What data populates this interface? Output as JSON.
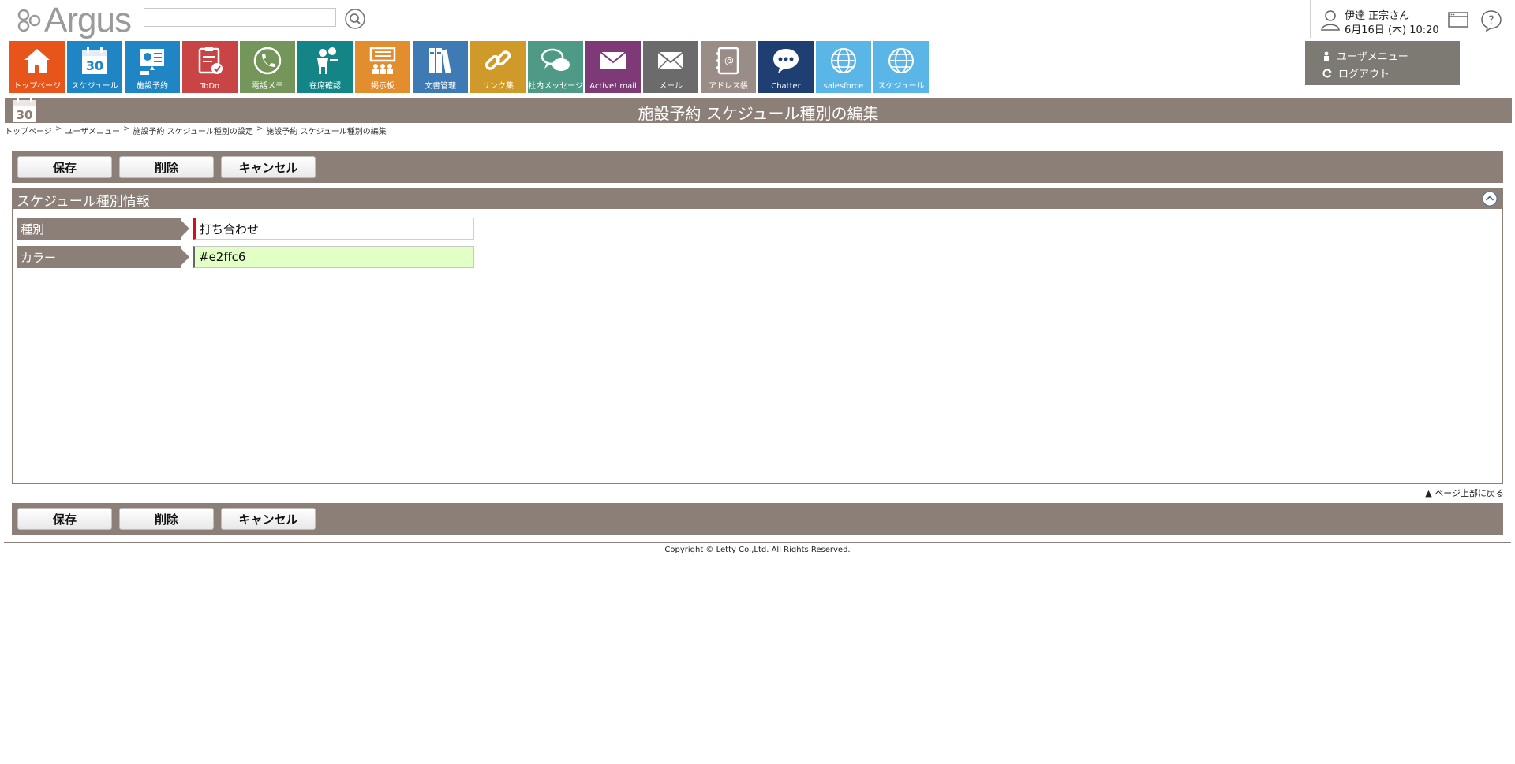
{
  "app": {
    "logo_text": "Argus"
  },
  "search": {
    "placeholder": ""
  },
  "user": {
    "name": "伊達 正宗さん",
    "datetime": "6月16日 (木) 10:20"
  },
  "user_menu": {
    "menu_label": "ユーザメニュー",
    "logout_label": "ログアウト"
  },
  "tiles": [
    {
      "label": "トップページ",
      "color": "#e8551b",
      "icon": "home-icon"
    },
    {
      "label": "スケジュール",
      "color": "#1f85c5",
      "icon": "calendar-icon",
      "icon_text": "30"
    },
    {
      "label": "施設予約",
      "color": "#1f85c5",
      "icon": "facility-icon"
    },
    {
      "label": "ToDo",
      "color": "#c94545",
      "icon": "todo-icon"
    },
    {
      "label": "電話メモ",
      "color": "#75965b",
      "icon": "phone-icon"
    },
    {
      "label": "在席確認",
      "color": "#138586",
      "icon": "presence-icon"
    },
    {
      "label": "掲示板",
      "color": "#e28d2e",
      "icon": "board-icon"
    },
    {
      "label": "文書管理",
      "color": "#3e7ab4",
      "icon": "document-icon"
    },
    {
      "label": "リンク集",
      "color": "#d09a2a",
      "icon": "link-icon"
    },
    {
      "label": "社内メッセージ",
      "color": "#4f9a87",
      "icon": "message-icon"
    },
    {
      "label": "Active! mail",
      "color": "#7d3a77",
      "icon": "active-mail-icon"
    },
    {
      "label": "メール",
      "color": "#6b6b6b",
      "icon": "mail-icon"
    },
    {
      "label": "アドレス帳",
      "color": "#9a8c86",
      "icon": "address-book-icon"
    },
    {
      "label": "Chatter",
      "color": "#1f3e72",
      "icon": "chatter-icon"
    },
    {
      "label": "salesforce",
      "color": "#59b6e6",
      "icon": "globe-icon"
    },
    {
      "label": "スケジュール",
      "color": "#59b6e6",
      "icon": "globe-icon"
    }
  ],
  "page": {
    "title": "施設予約 スケジュール種別の編集"
  },
  "breadcrumb": [
    "トップページ",
    "ユーザメニュー",
    "施設予約 スケジュール種別の設定",
    "施設予約 スケジュール種別の編集"
  ],
  "breadcrumb_sep": ">",
  "buttons": {
    "save": "保存",
    "delete": "削除",
    "cancel": "キャンセル"
  },
  "section": {
    "title": "スケジュール種別情報",
    "fields": [
      {
        "label": "種別",
        "value": "打ち合わせ"
      },
      {
        "label": "カラー",
        "value": "#e2ffc6"
      }
    ]
  },
  "back_to_top": "▲ ページ上部に戻る",
  "footer": {
    "copyright": "Copyright © Letty Co.,Ltd. All Rights Reserved."
  },
  "colors": {
    "bar": "#8b7f78",
    "required": "#c8161d",
    "color_field_bg": "#e2ffc6"
  }
}
